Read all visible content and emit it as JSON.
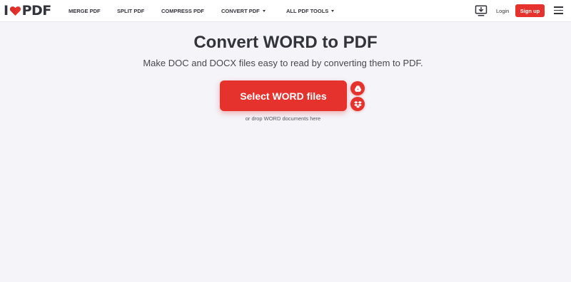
{
  "header": {
    "logo": {
      "prefix": "I",
      "suffix": "PDF"
    },
    "nav": [
      {
        "label": "MERGE PDF"
      },
      {
        "label": "SPLIT PDF"
      },
      {
        "label": "COMPRESS PDF"
      },
      {
        "label": "CONVERT PDF",
        "dropdown": true
      },
      {
        "label": "ALL PDF TOOLS",
        "dropdown": true
      }
    ],
    "desktop_icon": "desktop-download-icon",
    "login_label": "Login",
    "signup_label": "Sign up",
    "menu_icon": "hamburger-menu-icon"
  },
  "main": {
    "title": "Convert WORD to PDF",
    "subtitle": "Make DOC and DOCX files easy to read by converting them to PDF.",
    "select_button_label": "Select WORD files",
    "cloud_buttons": [
      {
        "icon": "google-drive-icon"
      },
      {
        "icon": "dropbox-icon"
      }
    ],
    "drop_hint": "or drop WORD documents here"
  },
  "colors": {
    "accent": "#e5322d",
    "text": "#33333b",
    "background": "#f4f4f9",
    "header_background": "#ffffff"
  }
}
